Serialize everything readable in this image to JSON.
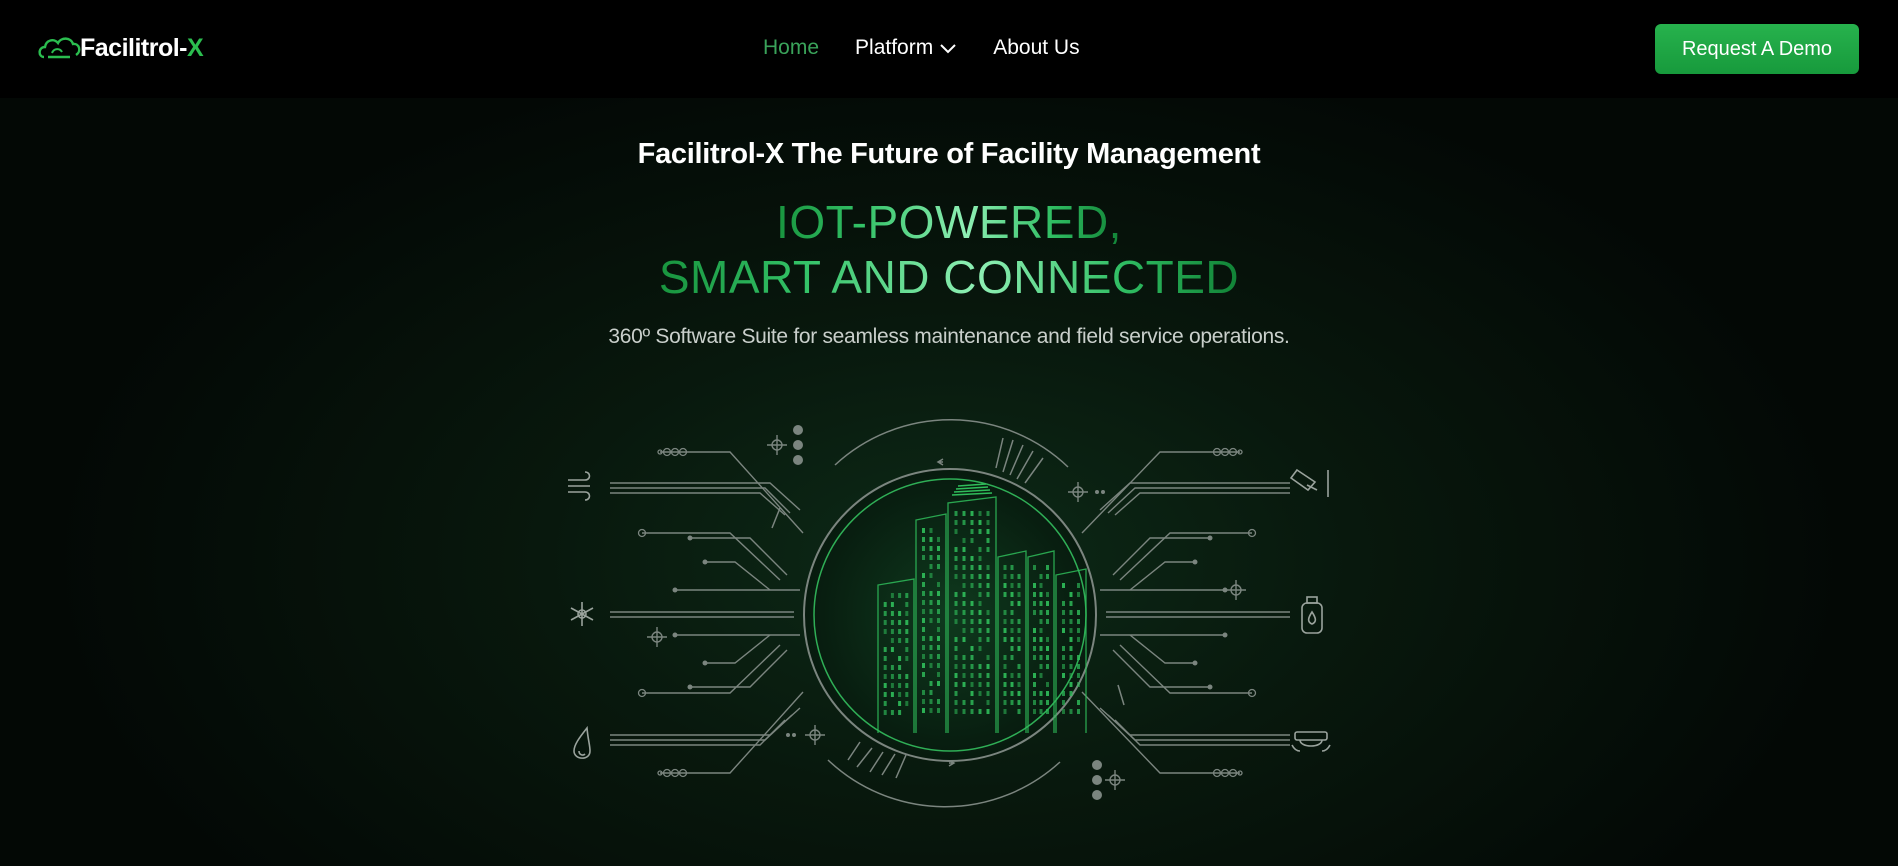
{
  "header": {
    "logo_text": "Facilitrol-",
    "logo_accent": "X",
    "nav": [
      {
        "label": "Home"
      },
      {
        "label": "Platform"
      },
      {
        "label": "About Us"
      }
    ],
    "cta_label": "Request A Demo"
  },
  "hero": {
    "title": "Facilitrol-X The Future of Facility Management",
    "headline_line1": "IOT-POWERED,",
    "headline_line2": "SMART AND CONNECTED",
    "subtitle": "360º Software Suite for seamless maintenance and field service operations."
  },
  "illustration": {
    "left_icons": [
      "wind-icon",
      "snowflake-icon",
      "water-drop-icon"
    ],
    "right_icons": [
      "security-camera-icon",
      "gas-cylinder-icon",
      "smoke-detector-icon"
    ]
  },
  "colors": {
    "accent": "#27b24d",
    "active_nav": "#3aa35a",
    "line": "#7b857f",
    "building": "#2fbd5a"
  }
}
